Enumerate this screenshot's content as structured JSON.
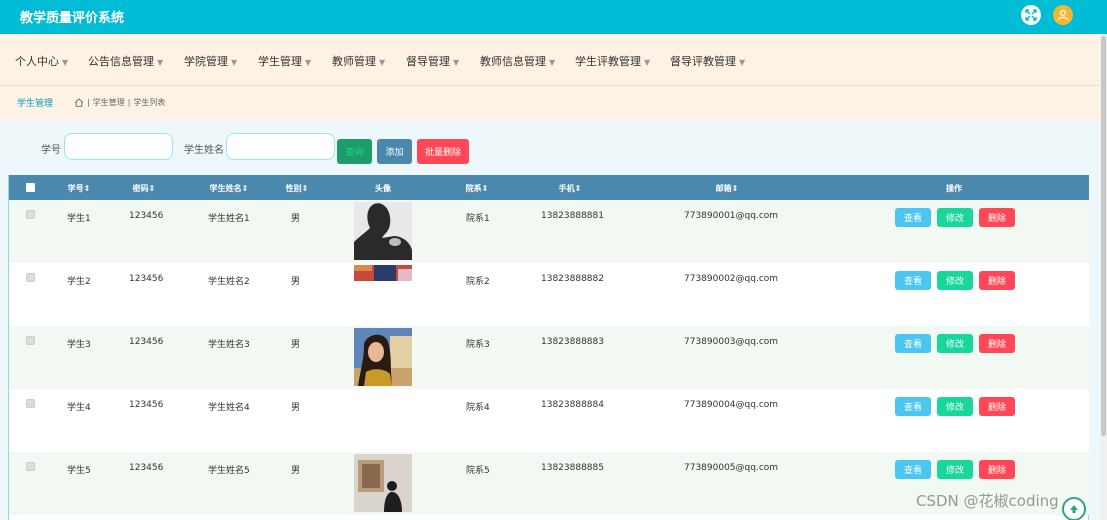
{
  "app": {
    "title": "教学质量评价系统"
  },
  "nav": {
    "items": [
      {
        "label": "个人中心"
      },
      {
        "label": "公告信息管理"
      },
      {
        "label": "学院管理"
      },
      {
        "label": "学生管理"
      },
      {
        "label": "教师管理"
      },
      {
        "label": "督导管理"
      },
      {
        "label": "教师信息管理"
      },
      {
        "label": "学生评教管理"
      },
      {
        "label": "督导评教管理"
      }
    ]
  },
  "breadcrumb": {
    "title": "学生管理",
    "path": [
      "学生管理",
      "学生列表"
    ]
  },
  "search": {
    "student_no_label": "学号",
    "student_no_value": "",
    "student_name_label": "学生姓名",
    "student_name_value": "",
    "query_label": "查询",
    "add_label": "添加",
    "batch_delete_label": "批量删除"
  },
  "table": {
    "columns": [
      "学号",
      "密码",
      "学生姓名",
      "性别",
      "头像",
      "院系",
      "手机",
      "邮箱",
      "操作"
    ],
    "rows": [
      {
        "no": "学生1",
        "password": "123456",
        "name": "学生姓名1",
        "gender": "男",
        "dept": "院系1",
        "phone": "13823888881",
        "email": "773890001@qq.com"
      },
      {
        "no": "学生2",
        "password": "123456",
        "name": "学生姓名2",
        "gender": "男",
        "dept": "院系2",
        "phone": "13823888882",
        "email": "773890002@qq.com"
      },
      {
        "no": "学生3",
        "password": "123456",
        "name": "学生姓名3",
        "gender": "男",
        "dept": "院系3",
        "phone": "13823888883",
        "email": "773890003@qq.com"
      },
      {
        "no": "学生4",
        "password": "123456",
        "name": "学生姓名4",
        "gender": "男",
        "dept": "院系4",
        "phone": "13823888884",
        "email": "773890004@qq.com"
      },
      {
        "no": "学生5",
        "password": "123456",
        "name": "学生姓名5",
        "gender": "男",
        "dept": "院系5",
        "phone": "13823888885",
        "email": "773890005@qq.com"
      }
    ],
    "actions": {
      "view": "查看",
      "edit": "修改",
      "delete": "删除"
    }
  },
  "watermark": "CSDN @花椒coding",
  "colors": {
    "topbar": "#00bcd4",
    "nav_bg": "#fdf2e4",
    "table_header": "#4a89ad",
    "view_button": "#4bc6f0",
    "edit_button": "#17d79c",
    "delete_button": "#ff4757",
    "query_button": "#1e9c6a",
    "add_button": "#4a89ad",
    "batch_delete_button": "#ff4757"
  }
}
